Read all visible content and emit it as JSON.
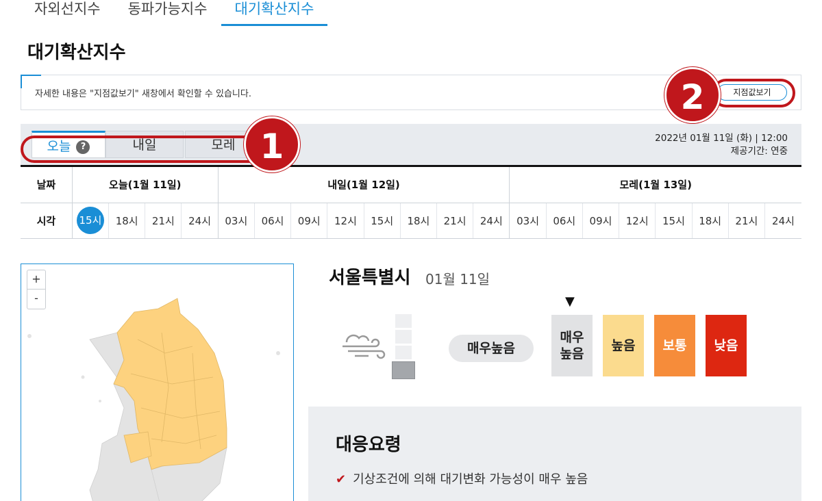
{
  "top_tabs": [
    "자외선지수",
    "동파가능지수",
    "대기확산지수"
  ],
  "page_title": "대기확산지수",
  "notice": {
    "text": "자세한 내용은 \"지점값보기\" 새창에서 확인할 수 있습니다.",
    "button": "지점값보기"
  },
  "day_tabs": [
    "오늘",
    "내일",
    "모레"
  ],
  "help_glyph": "?",
  "info": {
    "datetime": "2022년 01월 11일 (화) | 12:00",
    "period": "제공기간: 연중"
  },
  "badges": [
    "1",
    "2"
  ],
  "table": {
    "date_header": "날짜",
    "time_header": "시각",
    "dates": [
      "오늘(1월 11일)",
      "내일(1월 12일)",
      "모레(1월 13일)"
    ],
    "slots_today": [
      "15시",
      "18시",
      "21시",
      "24시"
    ],
    "slots_tomorrow": [
      "03시",
      "06시",
      "09시",
      "12시",
      "15시",
      "18시",
      "21시",
      "24시"
    ],
    "slots_after": [
      "03시",
      "06시",
      "09시",
      "12시",
      "15시",
      "18시",
      "21시",
      "24시"
    ]
  },
  "map": {
    "zoom_in": "+",
    "zoom_out": "-"
  },
  "city": "서울특별시",
  "city_date": "01월 11일",
  "current_level": "매우높음",
  "marker": "▼",
  "levels": [
    {
      "label": "매우\n높음",
      "color": "#e1e2e4",
      "text_color": "#222222"
    },
    {
      "label": "높음",
      "color": "#fbdb8e",
      "text_color": "#222222"
    },
    {
      "label": "보통",
      "color": "#f68c3a",
      "text_color": "#ffffff"
    },
    {
      "label": "낮음",
      "color": "#dd2711",
      "text_color": "#ffffff"
    }
  ],
  "response": {
    "title": "대응요령",
    "check": "✔",
    "item": "기상조건에 의해 대기변화 가능성이 매우 높음"
  },
  "colors": {
    "accent": "#1a8ed6",
    "highlight": "#c0171c",
    "map_high": "#fdd27f",
    "map_land": "#e3e3e3"
  }
}
